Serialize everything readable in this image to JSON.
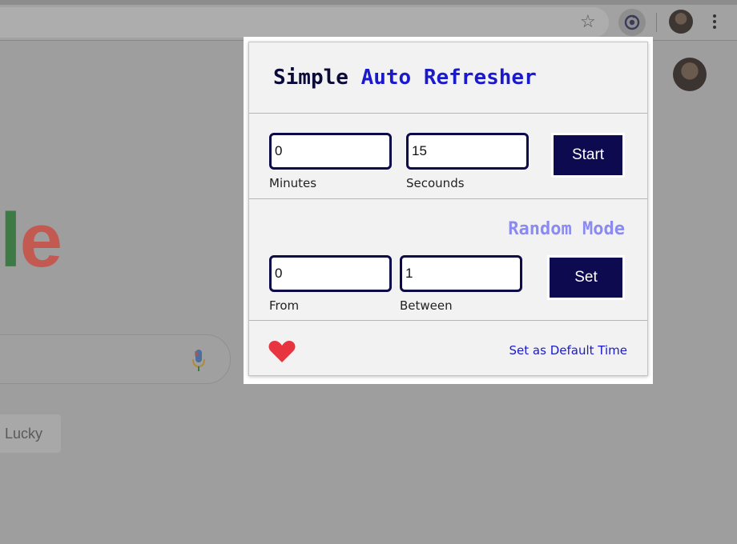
{
  "browser": {
    "star_icon": "star-outline-icon",
    "menu_icon": "kebab-menu-icon"
  },
  "page_behind": {
    "logo_partial": [
      "l",
      "e"
    ],
    "lucky_label": "Lucky"
  },
  "popup": {
    "title_word1": "Simple",
    "title_word2": "Auto Refresher",
    "timer": {
      "minutes_value": "0",
      "minutes_label": "Minutes",
      "seconds_value": "15",
      "seconds_label": "Secounds",
      "start_label": "Start"
    },
    "random": {
      "title": "Random Mode",
      "from_value": "0",
      "from_label": "From",
      "between_value": "1",
      "between_label": "Between",
      "set_label": "Set"
    },
    "footer": {
      "default_link": "Set as Default Time"
    }
  },
  "colors": {
    "brand_dark": "#0d0a50",
    "title_blue": "#1a1acc",
    "random_purple": "#8a8af0",
    "heart_red": "#e8343f"
  }
}
